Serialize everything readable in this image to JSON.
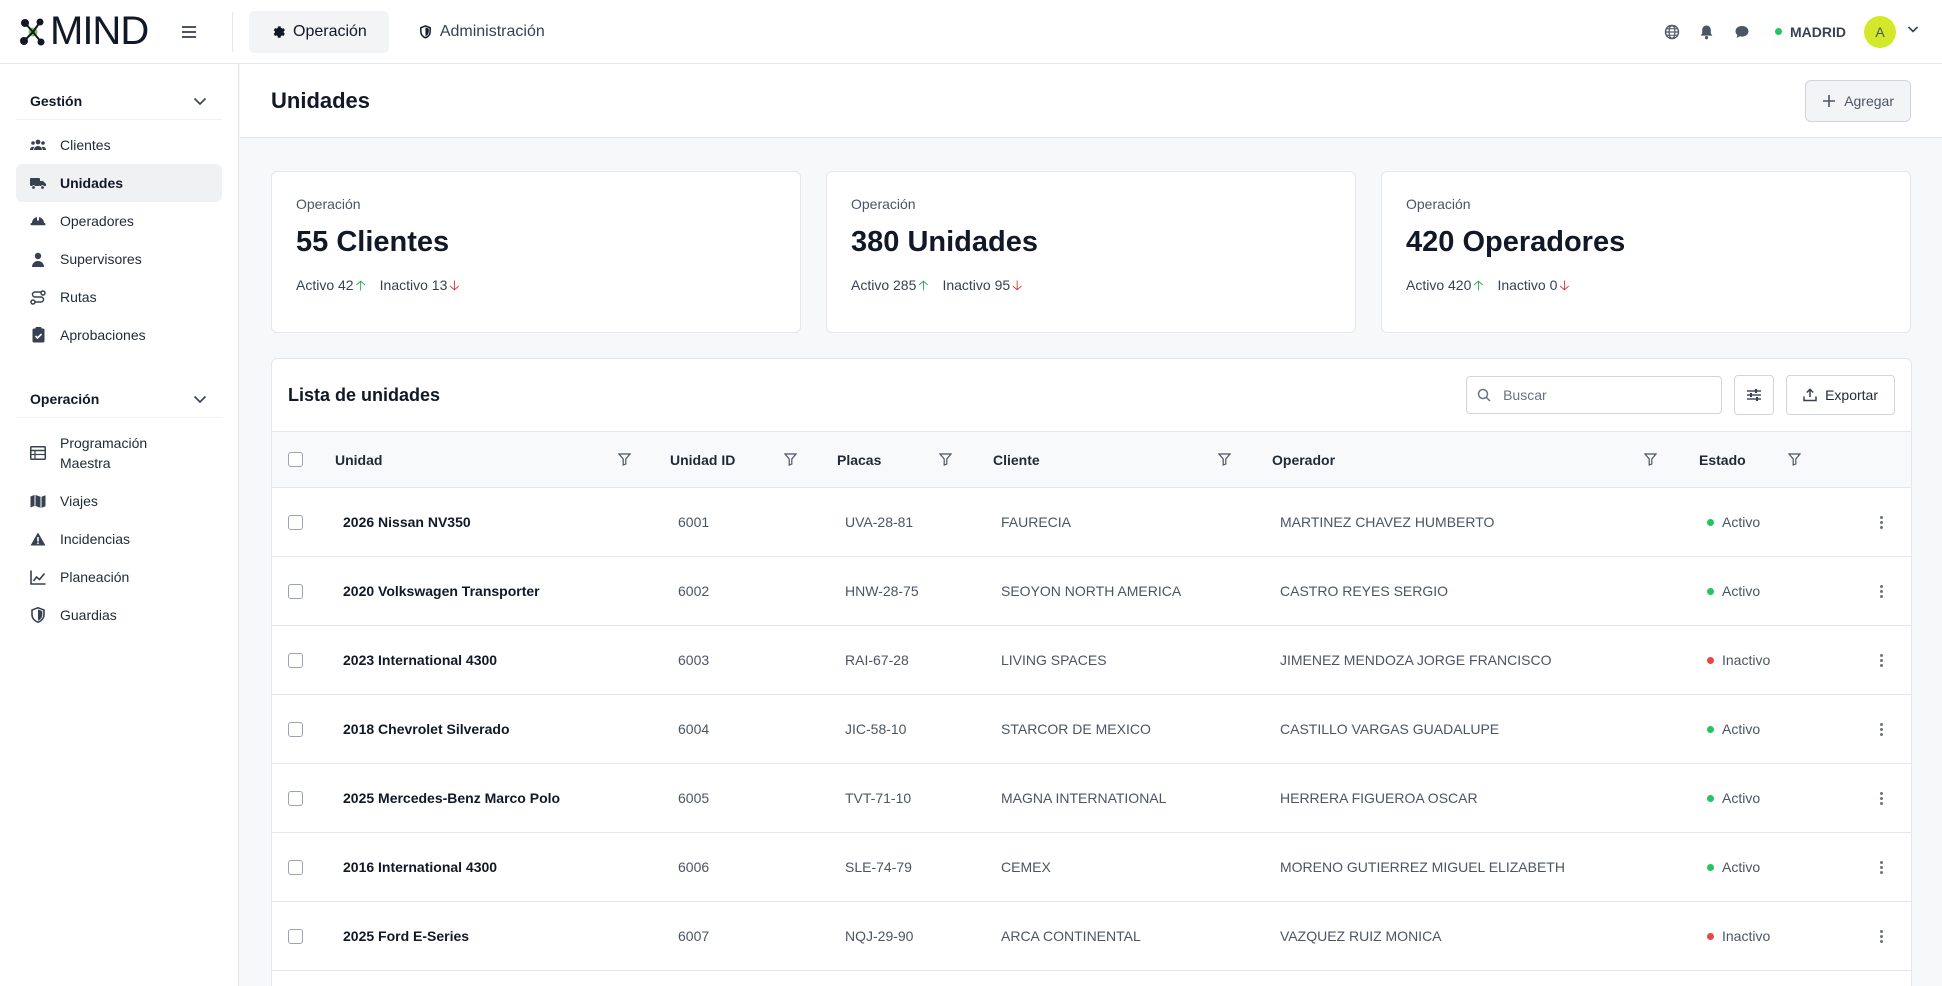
{
  "brand": {
    "name": "MIND"
  },
  "topnav": [
    {
      "label": "Operación",
      "icon": "gear-icon",
      "active": true
    },
    {
      "label": "Administración",
      "icon": "shield-icon",
      "active": false
    }
  ],
  "user": {
    "city": "MADRID",
    "avatar_initial": "A",
    "status_color": "#22c55e"
  },
  "sidebar": {
    "sections": [
      {
        "title": "Gestión",
        "items": [
          {
            "label": "Clientes",
            "icon": "users-icon",
            "active": false
          },
          {
            "label": "Unidades",
            "icon": "truck-icon",
            "active": true
          },
          {
            "label": "Operadores",
            "icon": "helmet-icon",
            "active": false
          },
          {
            "label": "Supervisores",
            "icon": "person-icon",
            "active": false
          },
          {
            "label": "Rutas",
            "icon": "route-icon",
            "active": false
          },
          {
            "label": "Aprobaciones",
            "icon": "clipboard-check-icon",
            "active": false
          }
        ]
      },
      {
        "title": "Operación",
        "items": [
          {
            "label": "Programación Maestra",
            "icon": "table-icon",
            "active": false
          },
          {
            "label": "Viajes",
            "icon": "map-icon",
            "active": false
          },
          {
            "label": "Incidencias",
            "icon": "warning-icon",
            "active": false
          },
          {
            "label": "Planeación",
            "icon": "chart-icon",
            "active": false
          },
          {
            "label": "Guardias",
            "icon": "shield-half-icon",
            "active": false
          }
        ]
      }
    ]
  },
  "page": {
    "title": "Unidades",
    "add_label": "Agregar"
  },
  "cards": [
    {
      "label": "Operación",
      "value": "55 Clientes",
      "active": "Activo 42",
      "inactive": "Inactivo 13"
    },
    {
      "label": "Operación",
      "value": "380 Unidades",
      "active": "Activo 285",
      "inactive": "Inactivo 95"
    },
    {
      "label": "Operación",
      "value": "420 Operadores",
      "active": "Activo 420",
      "inactive": "Inactivo 0"
    }
  ],
  "table": {
    "title": "Lista de unidades",
    "search_placeholder": "Buscar",
    "export_label": "Exportar",
    "columns": [
      "Unidad",
      "Unidad ID",
      "Placas",
      "Cliente",
      "Operador",
      "Estado"
    ],
    "rows": [
      {
        "unidad": "2026 Nissan NV350",
        "id": "6001",
        "placas": "UVA-28-81",
        "cliente": "FAURECIA",
        "operador": "MARTINEZ CHAVEZ HUMBERTO",
        "estado": "Activo"
      },
      {
        "unidad": "2020 Volkswagen Transporter",
        "id": "6002",
        "placas": "HNW-28-75",
        "cliente": "SEOYON NORTH AMERICA",
        "operador": "CASTRO REYES SERGIO",
        "estado": "Activo"
      },
      {
        "unidad": "2023 International 4300",
        "id": "6003",
        "placas": "RAI-67-28",
        "cliente": "LIVING SPACES",
        "operador": "JIMENEZ MENDOZA JORGE FRANCISCO",
        "estado": "Inactivo"
      },
      {
        "unidad": "2018 Chevrolet Silverado",
        "id": "6004",
        "placas": "JIC-58-10",
        "cliente": "STARCOR DE MEXICO",
        "operador": "CASTILLO VARGAS GUADALUPE",
        "estado": "Activo"
      },
      {
        "unidad": "2025 Mercedes-Benz Marco Polo",
        "id": "6005",
        "placas": "TVT-71-10",
        "cliente": "MAGNA INTERNATIONAL",
        "operador": "HERRERA FIGUEROA OSCAR",
        "estado": "Activo"
      },
      {
        "unidad": "2016 International 4300",
        "id": "6006",
        "placas": "SLE-74-79",
        "cliente": "CEMEX",
        "operador": "MORENO GUTIERREZ MIGUEL ELIZABETH",
        "estado": "Activo"
      },
      {
        "unidad": "2025 Ford E-Series",
        "id": "6007",
        "placas": "NQJ-29-90",
        "cliente": "ARCA CONTINENTAL",
        "operador": "VAZQUEZ RUIZ MONICA",
        "estado": "Inactivo"
      }
    ]
  },
  "colors": {
    "active": "#22c55e",
    "inactive": "#ef4444",
    "up_arrow": "#16a34a",
    "down_arrow": "#dc2626",
    "avatar_bg": "#d4e82a"
  }
}
